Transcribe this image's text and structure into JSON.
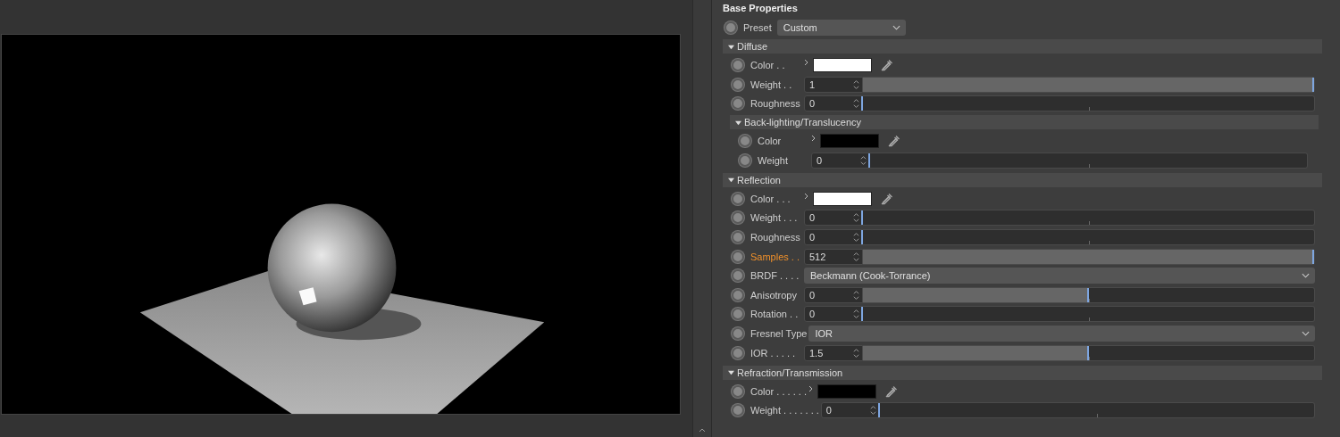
{
  "panel": {
    "title": "Base Properties"
  },
  "preset": {
    "label": "Preset",
    "value": "Custom"
  },
  "sections": [
    {
      "title": "Diffuse",
      "expanded": true,
      "rows": [
        {
          "kind": "color",
          "label": "Color . .",
          "modified": false,
          "color": "#ffffff"
        },
        {
          "kind": "number",
          "label": "Weight . .",
          "modified": false,
          "value": "1",
          "level": 1
        },
        {
          "kind": "number",
          "label": "Roughness",
          "modified": false,
          "value": "0",
          "level": 0
        }
      ],
      "subsections": [
        {
          "title": "Back-lighting/Translucency",
          "expanded": true,
          "rows": [
            {
              "kind": "color",
              "label": "Color",
              "modified": false,
              "color": "#000000"
            },
            {
              "kind": "number",
              "label": "Weight",
              "modified": false,
              "value": "0",
              "level": 0
            }
          ]
        }
      ]
    },
    {
      "title": "Reflection",
      "expanded": true,
      "rows": [
        {
          "kind": "color",
          "label": "Color . . .",
          "modified": false,
          "color": "#ffffff"
        },
        {
          "kind": "number",
          "label": "Weight . . .",
          "modified": false,
          "value": "0",
          "level": 0
        },
        {
          "kind": "number",
          "label": "Roughness",
          "modified": false,
          "value": "0",
          "level": 0
        },
        {
          "kind": "number",
          "label": "Samples . .",
          "modified": true,
          "value": "512",
          "level": 1
        },
        {
          "kind": "dropdown",
          "label": "BRDF . . . .",
          "modified": false,
          "value": "Beckmann (Cook-Torrance)"
        },
        {
          "kind": "number",
          "label": "Anisotropy",
          "modified": false,
          "value": "0",
          "level": 0.5
        },
        {
          "kind": "number",
          "label": "Rotation . .",
          "modified": false,
          "value": "0",
          "level": 0
        },
        {
          "kind": "dropdown",
          "label": "Fresnel Type",
          "modified": false,
          "value": "IOR"
        },
        {
          "kind": "number",
          "label": "IOR . . . . .",
          "modified": false,
          "value": "1.5",
          "level": 0.5
        }
      ]
    },
    {
      "title": "Refraction/Transmission",
      "expanded": true,
      "rows": [
        {
          "kind": "color",
          "label": "Color . . . . . .",
          "modified": false,
          "color": "#000000"
        },
        {
          "kind": "number",
          "label": "Weight . . . . . . .",
          "modified": false,
          "value": "0",
          "level": 0
        }
      ]
    }
  ]
}
